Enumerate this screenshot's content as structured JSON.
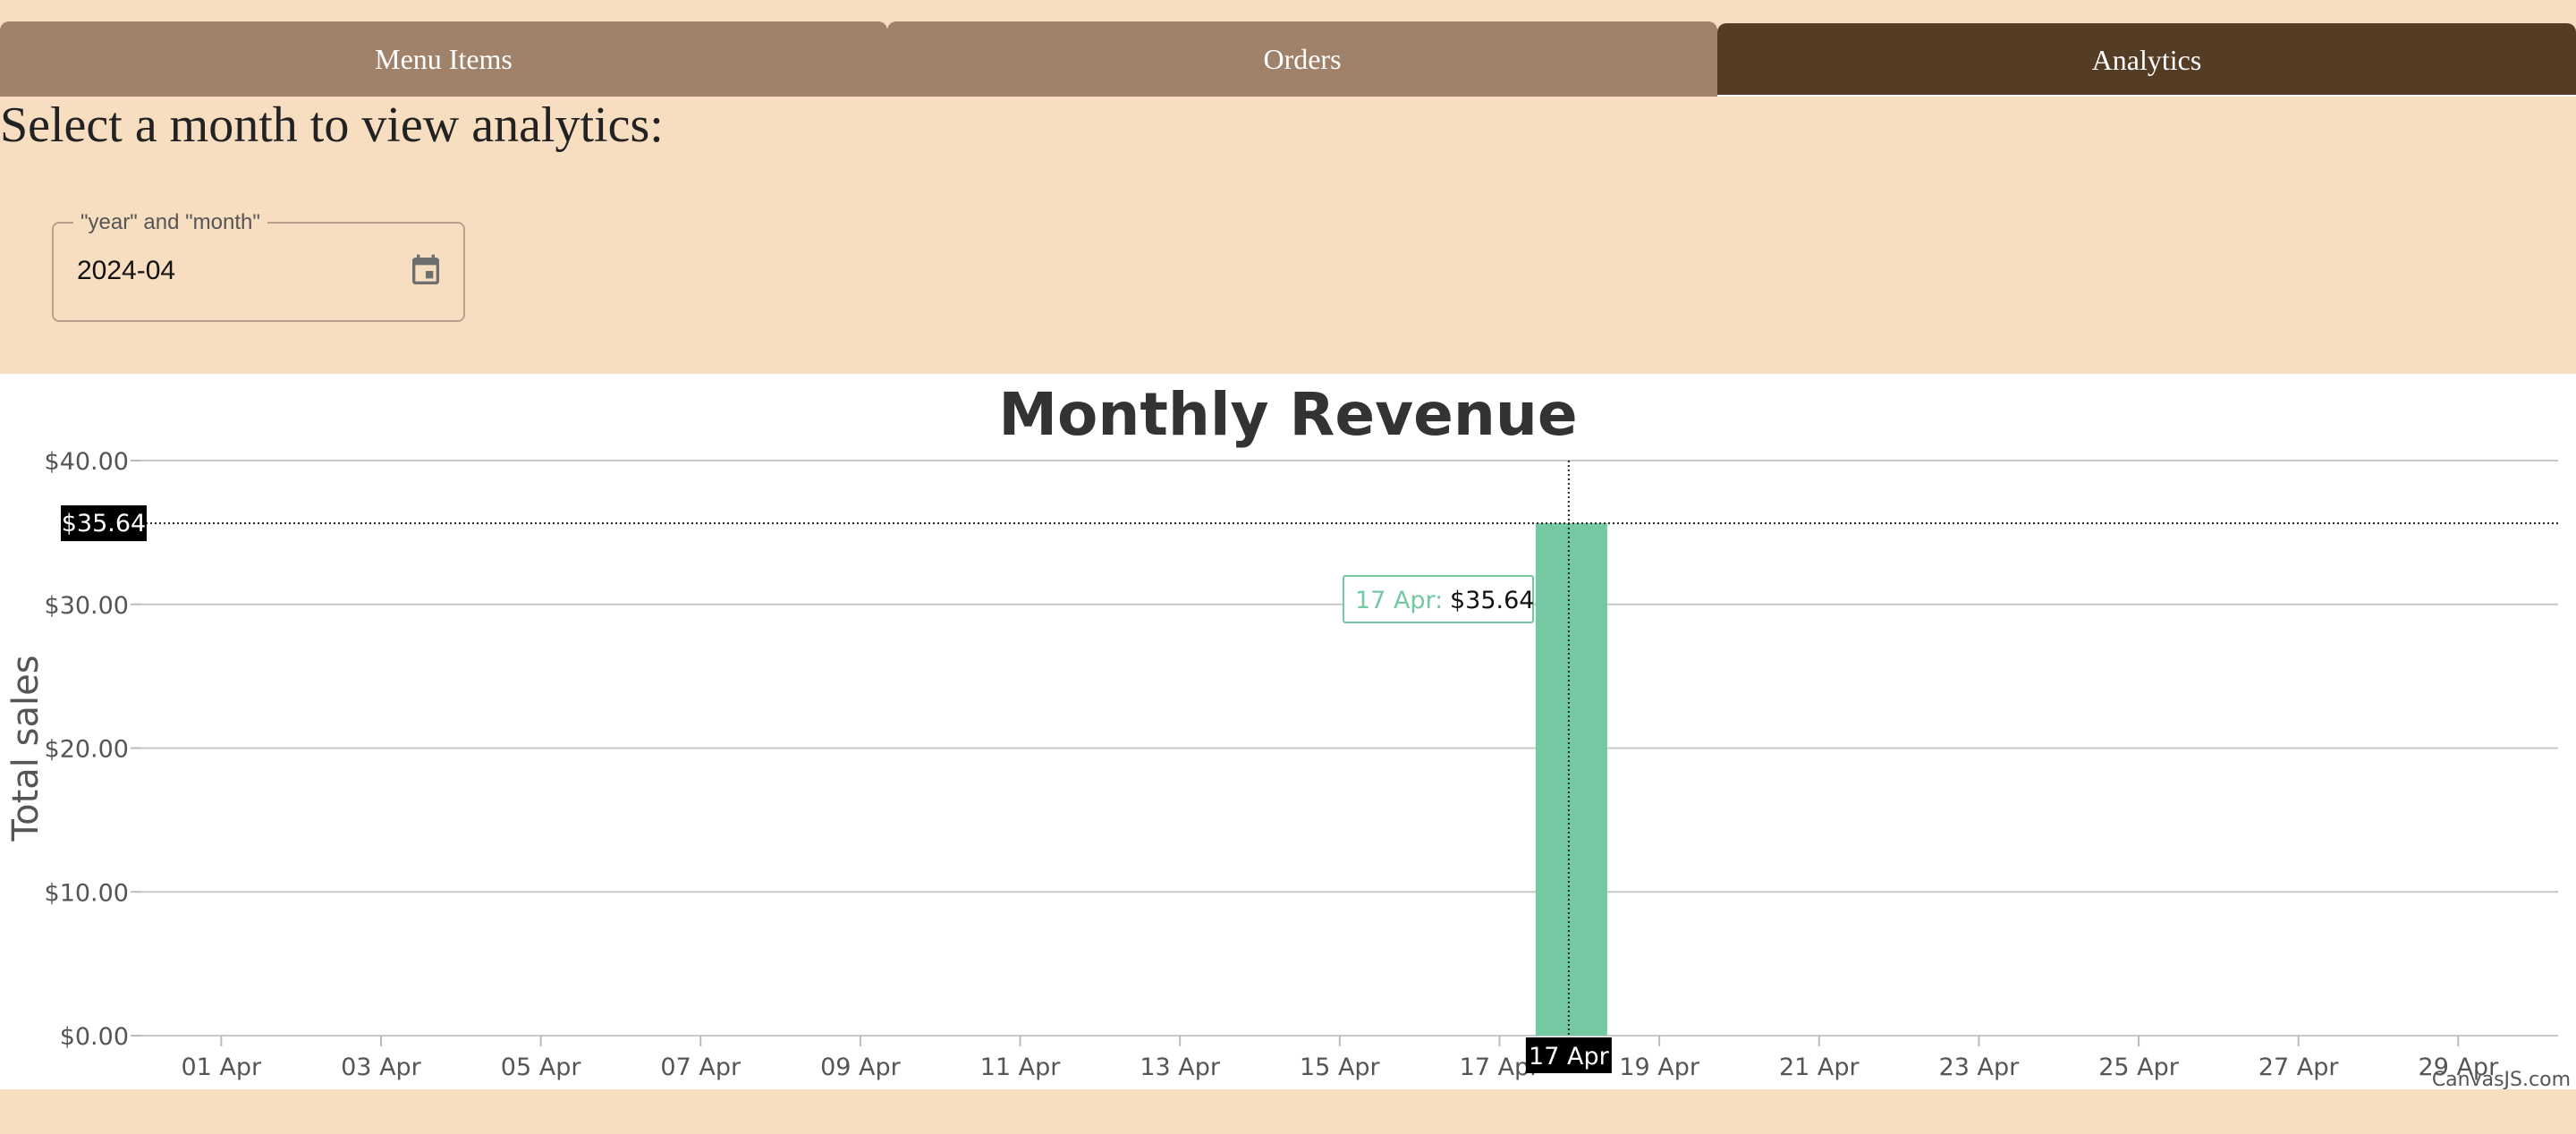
{
  "tabs": [
    {
      "label": "Menu Items",
      "active": false
    },
    {
      "label": "Orders",
      "active": false
    },
    {
      "label": "Analytics",
      "active": true
    }
  ],
  "prompt": "Select a month to view analytics:",
  "month_field": {
    "legend": "\"year\" and \"month\"",
    "value": "2024-04",
    "icon": "calendar-icon"
  },
  "colors": {
    "page_bg": "#f8dec1",
    "tab_inactive": "#a0826a",
    "tab_active": "#553c25",
    "bar": "#74c9a3"
  },
  "chart_data": {
    "type": "bar",
    "title": "Monthly Revenue",
    "ylabel": "Total sales",
    "xlabel": "",
    "ylim": [
      0,
      40
    ],
    "y_ticks": [
      "$0.00",
      "$10.00",
      "$20.00",
      "$30.00",
      "$40.00"
    ],
    "y_tick_values": [
      0,
      10,
      20,
      30,
      40
    ],
    "x_ticks": [
      "01 Apr",
      "03 Apr",
      "05 Apr",
      "07 Apr",
      "09 Apr",
      "11 Apr",
      "13 Apr",
      "15 Apr",
      "17 Apr",
      "19 Apr",
      "21 Apr",
      "23 Apr",
      "25 Apr",
      "27 Apr",
      "29 Apr"
    ],
    "x_tick_days": [
      1,
      3,
      5,
      7,
      9,
      11,
      13,
      15,
      17,
      19,
      21,
      23,
      25,
      27,
      29
    ],
    "xlim_days": [
      0,
      30.25
    ],
    "points": [
      {
        "day": 17.9,
        "value": 35.64
      }
    ],
    "grid": true,
    "crosshair": {
      "x_label": "17 Apr",
      "y_label": "$35.64"
    },
    "tooltip": {
      "label": "17 Apr:",
      "value": "$35.64"
    },
    "credit": "CanvasJS.com"
  }
}
